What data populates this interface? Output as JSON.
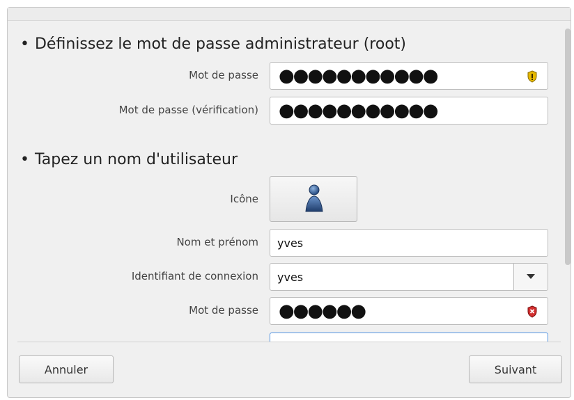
{
  "root_section": {
    "title": "Définissez le mot de passe administrateur (root)",
    "password_label": "Mot de passe",
    "password_value": "●●●●●●●●●●●",
    "password_strength_icon": "shield-yellow-icon",
    "verify_label": "Mot de passe (vérification)",
    "verify_value": "●●●●●●●●●●●"
  },
  "user_section": {
    "title": "Tapez un nom d'utilisateur",
    "icon_label": "Icône",
    "icon_name": "user-avatar-icon",
    "fullname_label": "Nom et prénom",
    "fullname_value": "yves",
    "login_label": "Identifiant de connexion",
    "login_value": "yves",
    "password_label": "Mot de passe",
    "password_value": "●●●●●●",
    "password_strength_icon": "shield-red-icon"
  },
  "buttons": {
    "cancel": "Annuler",
    "next": "Suivant"
  },
  "colors": {
    "strength_weak": "#d32f2f",
    "strength_medium": "#e6b800",
    "focus_border": "#5294e2"
  }
}
